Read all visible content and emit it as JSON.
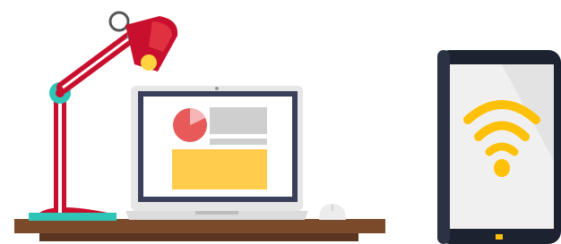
{
  "scene": {
    "items": [
      "desk-lamp-icon",
      "laptop-icon",
      "desk-icon",
      "mouse-icon",
      "tablet-icon",
      "wifi-icon"
    ]
  },
  "colors": {
    "lamp_red": "#c8102e",
    "lamp_stripe": "#ffffff",
    "lamp_joint": "#2ec4b6",
    "lamp_bulb": "#ffd23f",
    "desk_top": "#7a4a2b",
    "desk_shadow": "#5a3520",
    "laptop_frame": "#e6e6e6",
    "laptop_screen_border": "#3a3f5c",
    "laptop_screen": "#ffffff",
    "pie_red": "#e85a5a",
    "pie_light": "#f4b6b6",
    "placeholder_gray": "#cfcfcf",
    "placeholder_yellow": "#ffcc4d",
    "tablet_frame": "#1c2230",
    "tablet_screen": "#f0f0f0",
    "wifi_yellow": "#ffc107"
  }
}
